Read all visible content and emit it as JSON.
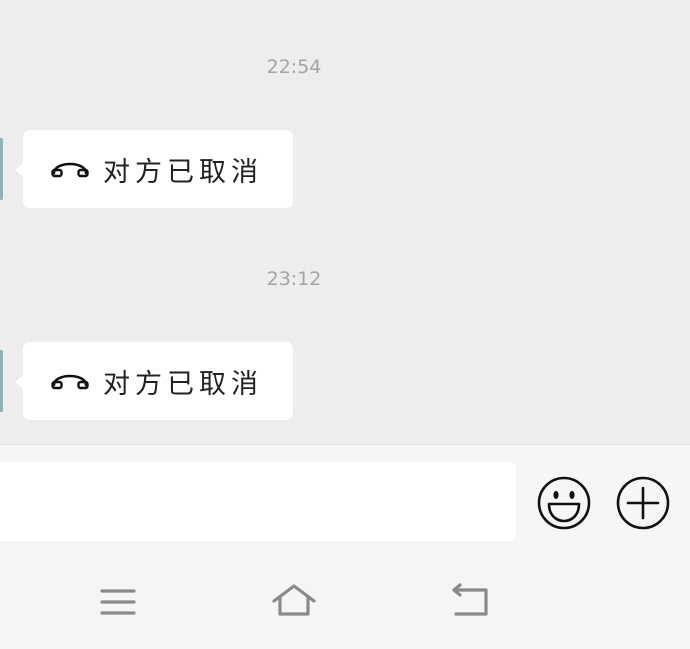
{
  "messages": [
    {
      "timestamp": "22:54",
      "text": "对方已取消",
      "icon": "hangup-phone-icon"
    },
    {
      "timestamp": "23:12",
      "text": "对方已取消",
      "icon": "hangup-phone-icon"
    }
  ],
  "input_bar": {
    "message_value": "",
    "emoji_icon": "smiley-face-icon",
    "plus_icon": "plus-circle-icon"
  },
  "nav_bar": {
    "menu_icon": "menu-icon",
    "home_icon": "home-icon",
    "back_icon": "back-icon"
  },
  "colors": {
    "chat_background": "#ededed",
    "bubble": "#ffffff",
    "timestamp_text": "#a4a4a4",
    "icon_stroke": "#111111",
    "nav_icon": "#8a8a8a"
  }
}
